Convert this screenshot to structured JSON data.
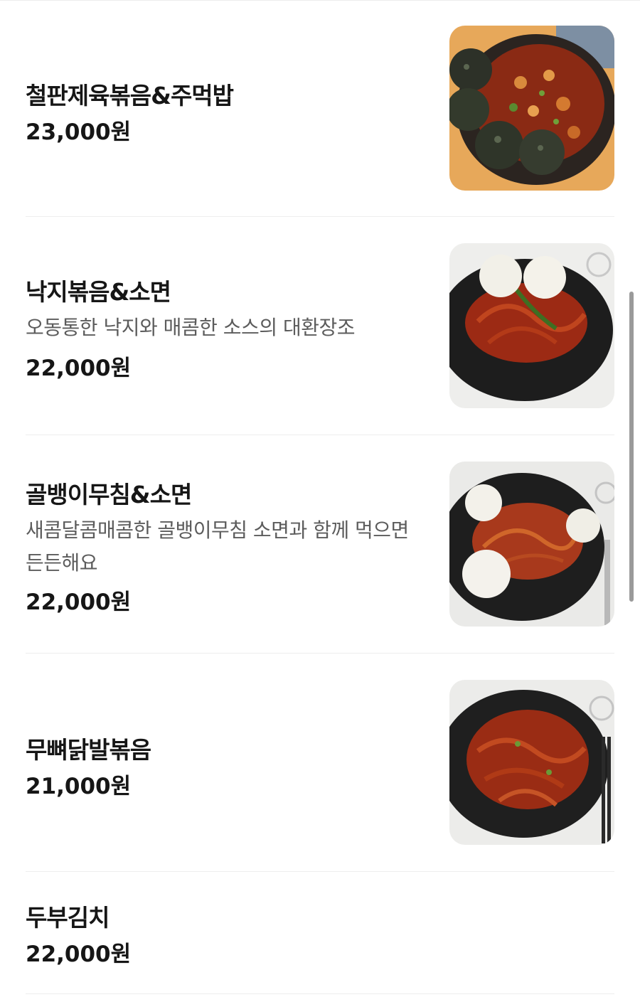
{
  "menu": {
    "items": [
      {
        "name": "철판제육볶음&주먹밥",
        "description": "",
        "price": "23,000원",
        "image_icon": "food-photo-icon"
      },
      {
        "name": "낙지볶음&소면",
        "description": "오동통한 낙지와 매콤한 소스의 대환장조",
        "price": "22,000원",
        "image_icon": "food-photo-icon"
      },
      {
        "name": "골뱅이무침&소면",
        "description": "새콤달콤매콤한 골뱅이무침 소면과 함께 먹으면 든든해요",
        "price": "22,000원",
        "image_icon": "food-photo-icon"
      },
      {
        "name": "무뼈닭발볶음",
        "description": "",
        "price": "21,000원",
        "image_icon": "food-photo-icon"
      },
      {
        "name": "두부김치",
        "description": "",
        "price": "22,000원"
      }
    ]
  },
  "colors": {
    "background": "#ffffff",
    "title_text": "#161616",
    "description_text": "#5c5c5c",
    "divider": "#eeeeee",
    "sauce_red": "#b0301a"
  }
}
